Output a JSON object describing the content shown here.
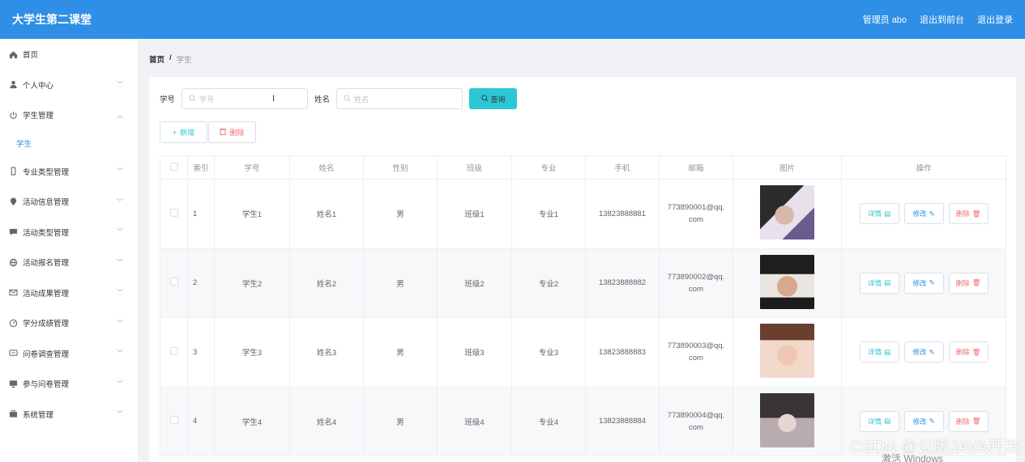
{
  "header": {
    "title": "大学生第二课堂",
    "admin_label": "管理员 abo",
    "to_front_label": "退出到前台",
    "logout_label": "退出登录"
  },
  "sidebar": {
    "items": [
      {
        "label": "首页",
        "icon": "home-icon"
      },
      {
        "label": "个人中心",
        "icon": "user-icon"
      },
      {
        "label": "学生管理",
        "icon": "power-icon"
      },
      {
        "label": "专业类型管理",
        "icon": "phone-icon"
      },
      {
        "label": "活动信息管理",
        "icon": "location-icon"
      },
      {
        "label": "活动类型管理",
        "icon": "chat-icon"
      },
      {
        "label": "活动报名管理",
        "icon": "globe-icon"
      },
      {
        "label": "活动成果管理",
        "icon": "mail-icon"
      },
      {
        "label": "学分成绩管理",
        "icon": "gauge-icon"
      },
      {
        "label": "问卷调查管理",
        "icon": "comment-icon"
      },
      {
        "label": "参与问卷管理",
        "icon": "monitor-icon"
      },
      {
        "label": "系统管理",
        "icon": "briefcase-icon"
      }
    ],
    "subitem_student": "学生"
  },
  "breadcrumb": {
    "home": "首页",
    "separator": "/",
    "current": "学生"
  },
  "search": {
    "student_no_label": "学号",
    "student_no_placeholder": "学号",
    "name_label": "姓名",
    "name_placeholder": "姓名",
    "query_label": "查询"
  },
  "actions": {
    "add_label": "新增",
    "delete_label": "删除"
  },
  "table": {
    "headers": [
      "索引",
      "学号",
      "姓名",
      "性别",
      "班级",
      "专业",
      "手机",
      "邮箱",
      "图片",
      "操作"
    ],
    "rows": [
      {
        "index": "1",
        "student_no": "学生1",
        "name": "姓名1",
        "gender": "男",
        "class": "班级1",
        "major": "专业1",
        "phone": "13823888881",
        "email_line1": "773890001@qq.",
        "email_line2": "com"
      },
      {
        "index": "2",
        "student_no": "学生2",
        "name": "姓名2",
        "gender": "男",
        "class": "班级2",
        "major": "专业2",
        "phone": "13823888882",
        "email_line1": "773890002@qq.",
        "email_line2": "com"
      },
      {
        "index": "3",
        "student_no": "学生3",
        "name": "姓名3",
        "gender": "男",
        "class": "班级3",
        "major": "专业3",
        "phone": "13823888883",
        "email_line1": "773890003@qq.",
        "email_line2": "com"
      },
      {
        "index": "4",
        "student_no": "学生4",
        "name": "姓名4",
        "gender": "男",
        "class": "班级4",
        "major": "专业4",
        "phone": "13823888884",
        "email_line1": "773890004@qq.",
        "email_line2": "com"
      }
    ],
    "op_detail": "详情",
    "op_edit": "修改",
    "op_delete": "删除"
  },
  "overlay": {
    "watermark": "CSDN @公版JAVA开发",
    "windows_activate": "激活 Windows"
  },
  "colors": {
    "primary": "#2f8ee5",
    "accent": "#2cc7d5",
    "danger": "#f56c6c"
  }
}
